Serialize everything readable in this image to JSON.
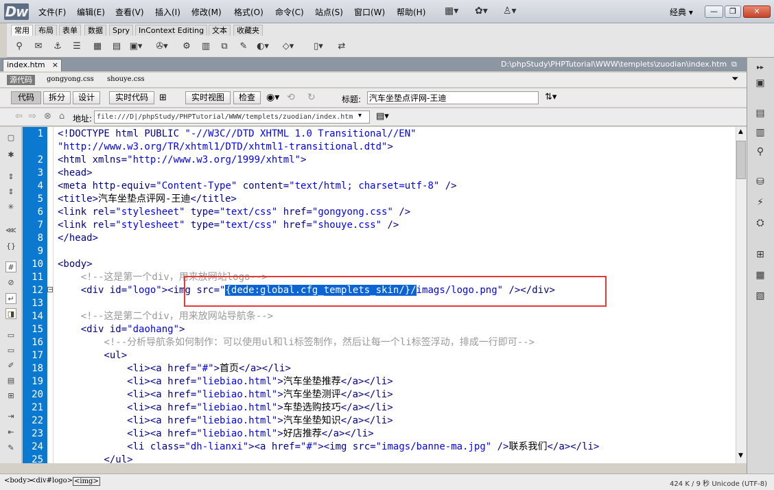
{
  "app": {
    "logo": "Dw"
  },
  "menu": [
    "文件(F)",
    "编辑(E)",
    "查看(V)",
    "插入(I)",
    "修改(M)",
    "格式(O)",
    "命令(C)",
    "站点(S)",
    "窗口(W)",
    "帮助(H)"
  ],
  "workspace_label": "经典",
  "window_buttons": {
    "minimize": "—",
    "restore": "❐",
    "close": "✕"
  },
  "insert_tabs": [
    "常用",
    "布局",
    "表单",
    "数据",
    "Spry",
    "InContext Editing",
    "文本",
    "收藏夹"
  ],
  "document": {
    "tab_name": "index.htm",
    "path": "D:\\phpStudy\\PHPTutorial\\WWW\\templets\\zuodian\\index.htm",
    "related_files": [
      "gongyong.css",
      "shouye.css"
    ],
    "source_label": "源代码"
  },
  "doc_toolbar": {
    "code_view": "代码",
    "split_view": "拆分",
    "design_view": "设计",
    "live_code": "实时代码",
    "live_view": "实时视图",
    "inspect": "检查",
    "title_label": "标题:",
    "title_value": "汽车坐垫点评网-王迪"
  },
  "nav": {
    "address_label": "地址:",
    "address_value": "file:///D|/phpStudy/PHPTutorial/WWW/templets/zuodian/index.htm"
  },
  "code": {
    "line_numbers": [
      "1",
      "",
      "2",
      "3",
      "4",
      "5",
      "6",
      "7",
      "8",
      "9",
      "10",
      "11",
      "12",
      "13",
      "14",
      "15",
      "16",
      "17",
      "18",
      "19",
      "20",
      "21",
      "22",
      "23",
      "24",
      "25"
    ],
    "selection": "{dede:global.cfg_templets_skin/}/"
  },
  "status": {
    "tag_selector": [
      "<body>",
      "<div#logo>",
      "<img>"
    ],
    "info": "424 K / 9 秒  Unicode (UTF-8)"
  }
}
